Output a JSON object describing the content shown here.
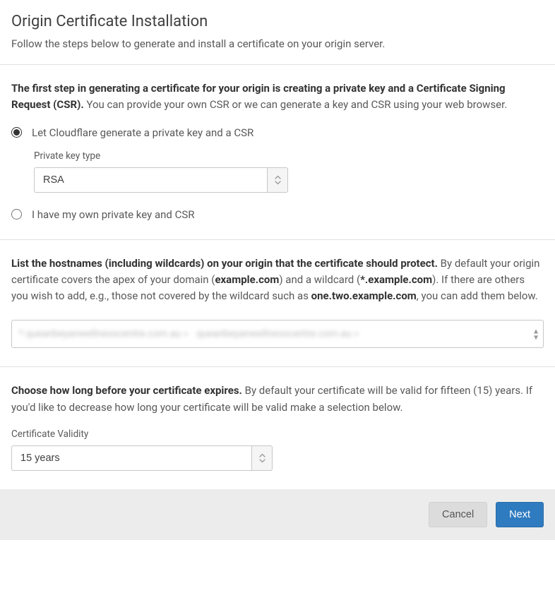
{
  "header": {
    "title": "Origin Certificate Installation",
    "subtitle": "Follow the steps below to generate and install a certificate on your origin server."
  },
  "step1": {
    "intro_bold": "The first step in generating a certificate for your origin is creating a private key and a Certificate Signing Request (CSR).",
    "intro_rest": " You can provide your own CSR or we can generate a key and CSR using your web browser.",
    "radio_generate": "Let Cloudflare generate a private key and a CSR",
    "private_key_type_label": "Private key type",
    "private_key_type_value": "RSA",
    "radio_own": "I have my own private key and CSR"
  },
  "step2": {
    "intro_bold": "List the hostnames (including wildcards) on your origin that the certificate should protect.",
    "intro_rest_1": " By default your origin certificate covers the apex of your domain (",
    "example1": "example.com",
    "intro_rest_2": ") and a wildcard (",
    "example2": "*.example.com",
    "intro_rest_3": "). If there are others you wish to add, e.g., those not covered by the wildcard such as ",
    "example3": "one.two.example.com",
    "intro_rest_4": ", you can add them below.",
    "tag1": "*.queanbeyanwellnesscentre.com.au",
    "tag2": "queanbeyanwellnesscentre.com.au"
  },
  "step3": {
    "intro_bold": "Choose how long before your certificate expires.",
    "intro_rest": " By default your certificate will be valid for fifteen (15) years. If you'd like to decrease how long your certificate will be valid make a selection below.",
    "validity_label": "Certificate Validity",
    "validity_value": "15 years"
  },
  "footer": {
    "cancel": "Cancel",
    "next": "Next"
  }
}
